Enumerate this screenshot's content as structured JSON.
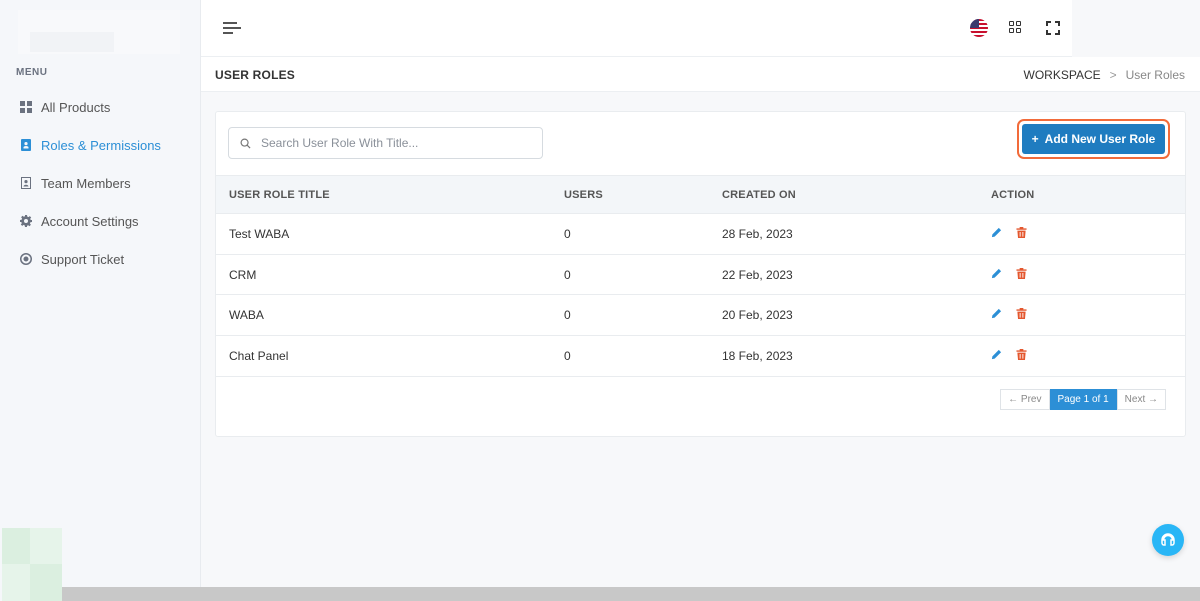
{
  "sidebar": {
    "menu_heading": "MENU",
    "items": [
      {
        "label": "All Products",
        "icon": "grid-icon",
        "active": false
      },
      {
        "label": "Roles & Permissions",
        "icon": "id-badge-icon",
        "active": true
      },
      {
        "label": "Team Members",
        "icon": "address-book-icon",
        "active": false
      },
      {
        "label": "Account Settings",
        "icon": "gear-icon",
        "active": false
      },
      {
        "label": "Support Ticket",
        "icon": "lifebuoy-icon",
        "active": false
      }
    ]
  },
  "header": {
    "icons": [
      "hamburger-icon",
      "us-flag-icon",
      "apps-grid-icon",
      "fullscreen-icon"
    ]
  },
  "page": {
    "title": "USER ROLES",
    "breadcrumb": {
      "parent": "WORKSPACE",
      "separator": ">",
      "current": "User Roles"
    }
  },
  "toolbar": {
    "search_placeholder": "Search User Role With Title...",
    "add_button_plus": "+",
    "add_button_label": "Add New User Role"
  },
  "table": {
    "headers": [
      "USER ROLE TITLE",
      "USERS",
      "CREATED ON",
      "ACTION"
    ],
    "rows": [
      {
        "title": "Test WABA",
        "users": "0",
        "created": "28 Feb, 2023"
      },
      {
        "title": "CRM",
        "users": "0",
        "created": "22 Feb, 2023"
      },
      {
        "title": "WABA",
        "users": "0",
        "created": "20 Feb, 2023"
      },
      {
        "title": "Chat Panel",
        "users": "0",
        "created": "18 Feb, 2023"
      }
    ]
  },
  "pagination": {
    "prev": "← Prev",
    "current": "Page 1 of 1",
    "next": "Next →"
  },
  "colors": {
    "accent": "#2c8fd6",
    "primary_button": "#1f7cc0",
    "highlight_outline": "#f26b3a",
    "edit_icon": "#2c8fd6",
    "delete_icon": "#e4572e",
    "help_button": "#29b6f6"
  }
}
